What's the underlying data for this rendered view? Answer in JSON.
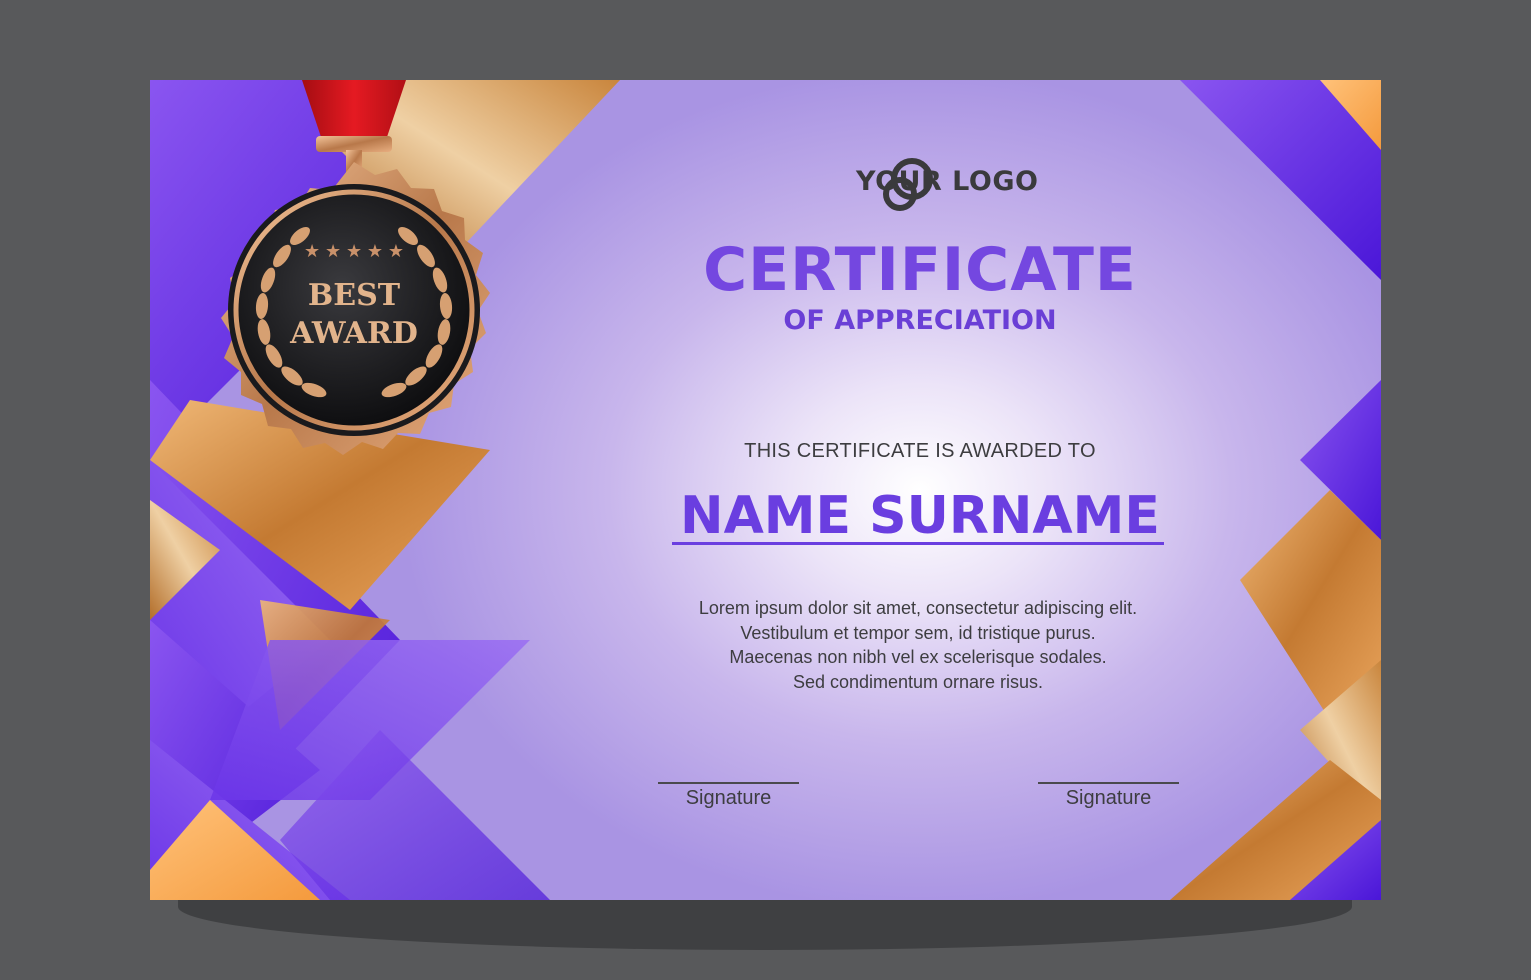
{
  "logo": {
    "text": "YOUR LOGO",
    "icon": "interlocked-rings-icon"
  },
  "medal": {
    "line1": "BEST",
    "line2": "AWARD",
    "stars": 5
  },
  "certificate": {
    "title": "CERTIFICATE",
    "subtitle": "OF APPRECIATION",
    "awarded_to": "THIS CERTIFICATE IS AWARDED TO",
    "name": "NAME SURNAME",
    "body": [
      "Lorem ipsum dolor sit amet, consectetur adipiscing elit.",
      "Vestibulum et tempor sem, id tristique purus.",
      "Maecenas non nibh vel ex scelerisque sodales.",
      "Sed condimentum ornare risus."
    ]
  },
  "signatures": [
    {
      "label": "Signature"
    },
    {
      "label": "Signature"
    }
  ],
  "colors": {
    "accent_purple": "#6a3ee0",
    "gold": "#c88a3e",
    "ribbon_red": "#d9141b",
    "background": "#58595b"
  }
}
